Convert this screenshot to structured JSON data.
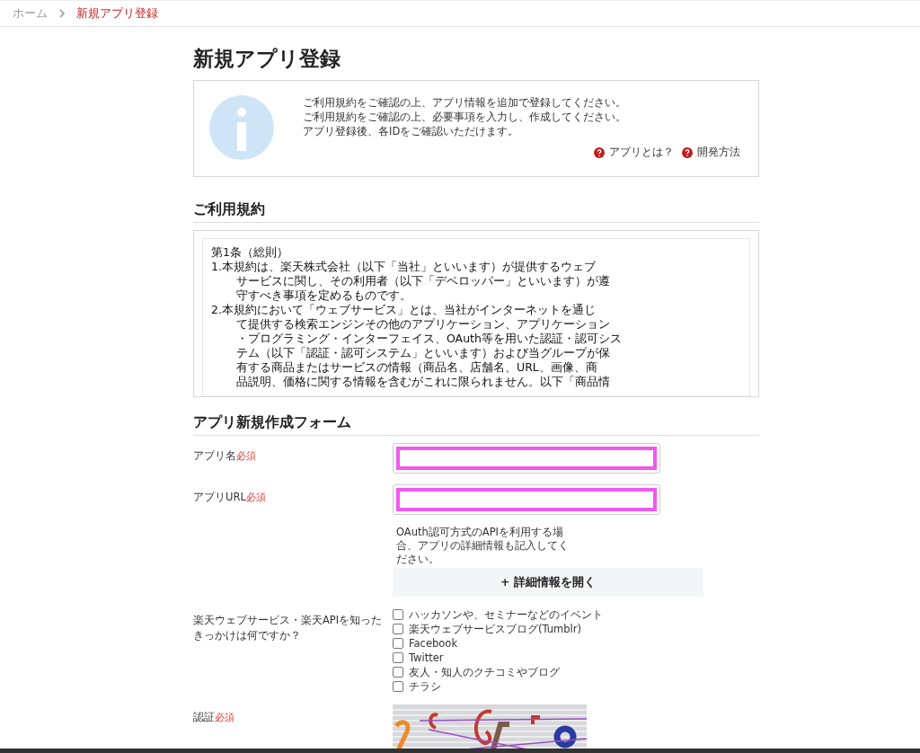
{
  "breadcrumb": [
    {
      "label": "ホーム",
      "selected": false
    },
    {
      "label": "新規アプリ登録",
      "selected": true
    }
  ],
  "page_title": "新規アプリ登録",
  "info": {
    "lines": [
      "ご利用規約をご確認の上、アプリ情報を追加で登録してください。",
      "ご利用規約をご確認の上、必要事項を入力し、作成してください。",
      "アプリ登録後、各IDをご確認いただけます。"
    ],
    "links": [
      "アプリとは？",
      "開発方法"
    ]
  },
  "terms": {
    "heading": "ご利用規約",
    "article": "第1条（総則）",
    "clauses": [
      {
        "lines": [
          "1.本規約は、楽天株式会社（以下「当社」といいます）が提供するウェブ",
          "サービスに関し、その利用者（以下「デベロッパー」といいます）が遵",
          "守すべき事項を定めるものです。"
        ]
      },
      {
        "lines": [
          "2.本規約において「ウェブサービス」とは、当社がインターネットを通じ",
          "て提供する検索エンジンその他のアプリケーション、アプリケーション",
          "・プログラミング・インターフェイス、OAuth等を用いた認証・認可シス",
          "テム（以下「認証・認可システム」といいます）および当グループが保",
          "有する商品またはサービスの情報（商品名、店舗名、URL、画像、商",
          "品説明、価格に関する情報を含むがこれに限られません。以下「商品情"
        ]
      }
    ]
  },
  "form": {
    "heading": "アプリ新規作成フォーム",
    "fields": [
      {
        "kind": "text",
        "label": "アプリ名",
        "required_mark": "必須",
        "highlighted": true
      },
      {
        "kind": "text",
        "label": "アプリURL",
        "required_mark": "必須",
        "highlighted": true,
        "note": "OAuth認可方式のAPIを利用する場合、アプリの詳細情報も記入してください。",
        "button": "+ 詳細情報を開く"
      },
      {
        "kind": "checkboxes",
        "label": "楽天ウェブサービス・楽天APIを知ったきっかけは何ですか？",
        "options": [
          {
            "label": "ハッカソンや、セミナーなどのイベント",
            "checked": false
          },
          {
            "label": "楽天ウェブサービスブログ(Tumblr)",
            "checked": false
          },
          {
            "label": "Facebook",
            "checked": false
          },
          {
            "label": "Twitter",
            "checked": false
          },
          {
            "label": "友人・知人のクチコミやブログ",
            "checked": false
          },
          {
            "label": "チラシ",
            "checked": false
          }
        ]
      },
      {
        "kind": "captcha",
        "label": "認証",
        "required_mark": "必須"
      }
    ]
  }
}
